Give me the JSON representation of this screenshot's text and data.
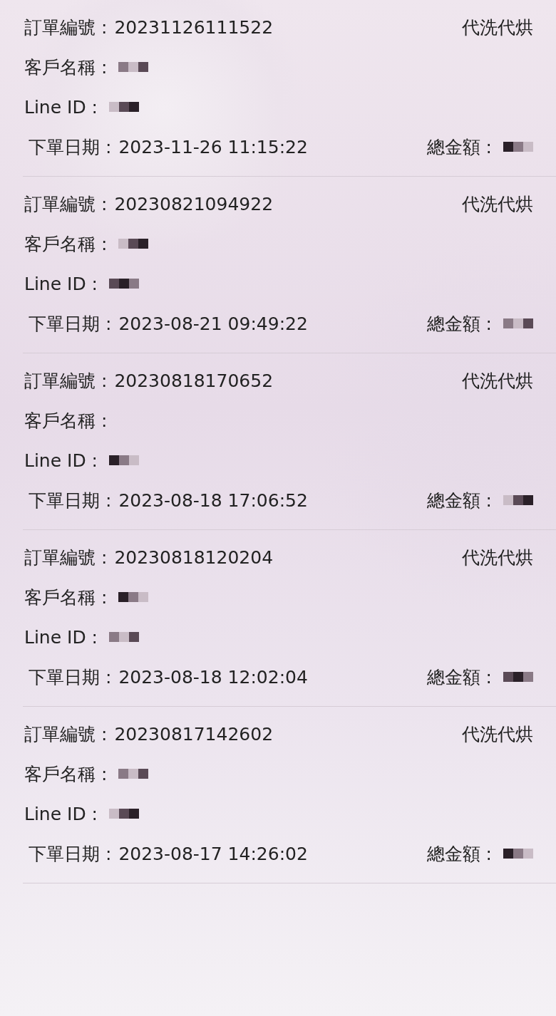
{
  "orders": [
    {
      "order_no": {
        "label": "訂單編號 :",
        "value": "20231126111522"
      },
      "service": "代洗代烘",
      "customer": {
        "label": "客戶名稱 :",
        "redacted": true
      },
      "line_id": {
        "label": "Line ID :",
        "redacted": true
      },
      "date": {
        "label": "下單日期 :",
        "value": "2023-11-26 11:15:22"
      },
      "total": {
        "label": "總金額 :",
        "redacted": true
      }
    },
    {
      "order_no": {
        "label": "訂單編號 :",
        "value": "20230821094922"
      },
      "service": "代洗代烘",
      "customer": {
        "label": "客戶名稱 :",
        "redacted": true
      },
      "line_id": {
        "label": "Line ID :",
        "redacted": true
      },
      "date": {
        "label": "下單日期 :",
        "value": "2023-08-21 09:49:22"
      },
      "total": {
        "label": "總金額 :",
        "redacted": true
      }
    },
    {
      "order_no": {
        "label": "訂單編號 :",
        "value": "20230818170652"
      },
      "service": "代洗代烘",
      "customer": {
        "label": "客戶名稱 :",
        "redacted": false
      },
      "line_id": {
        "label": "Line ID :",
        "redacted": true
      },
      "date": {
        "label": "下單日期 :",
        "value": "2023-08-18 17:06:52"
      },
      "total": {
        "label": "總金額 :",
        "redacted": true
      }
    },
    {
      "order_no": {
        "label": "訂單編號 :",
        "value": "20230818120204"
      },
      "service": "代洗代烘",
      "customer": {
        "label": "客戶名稱 :",
        "redacted": true
      },
      "line_id": {
        "label": "Line ID :",
        "redacted": true
      },
      "date": {
        "label": "下單日期 :",
        "value": "2023-08-18 12:02:04"
      },
      "total": {
        "label": "總金額 :",
        "redacted": true
      }
    },
    {
      "order_no": {
        "label": "訂單編號 :",
        "value": "20230817142602"
      },
      "service": "代洗代烘",
      "customer": {
        "label": "客戶名稱 :",
        "redacted": true
      },
      "line_id": {
        "label": "Line ID :",
        "redacted": true
      },
      "date": {
        "label": "下單日期 :",
        "value": "2023-08-17 14:26:02"
      },
      "total": {
        "label": "總金額 :",
        "redacted": true
      }
    }
  ]
}
